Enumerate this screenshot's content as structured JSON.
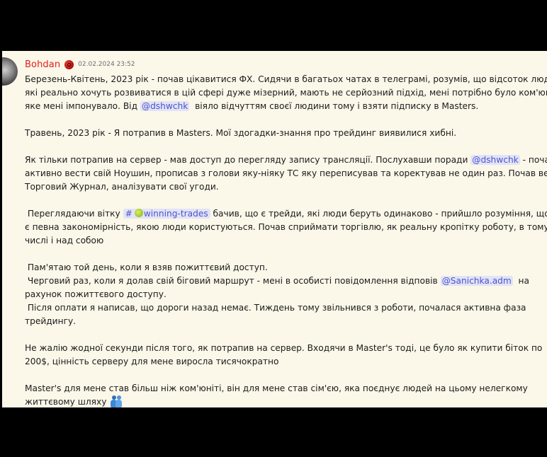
{
  "message": {
    "author": "Bohdan",
    "author_color": "#e0211b",
    "badge_icon": "role-badge-icon",
    "timestamp": "02.02.2024 23:52",
    "p1": {
      "l1": "Березень-Квітень, 2023 рік - почав цікавитися ФХ. Сидячи в багатьох чатах в телеграмі, розумів, що відсоток людей,",
      "l2": "які реально хочуть розвиватися в цій сфері дуже мізерний, мають не серйозний підхід, мені потрібно було ком'юніті,",
      "l3_a": "яке мені імпонувало. Від ",
      "mention": "@dshwchk",
      "l3_b": "  віяло відчуттям своєї людини тому і взяти підписку в Masters."
    },
    "p2": {
      "l1": "Травень, 2023 рік - Я потрапив в Masters. Мої здогадки-знання про трейдинг виявилися хибні."
    },
    "p3": {
      "l1_a": "Як тільки потрапив на сервер - мав доступ до перегляду запису трансляції. Послухавши поради ",
      "mention": "@dshwchk",
      "l1_b": " - почав",
      "l2": "активно вести свій Ноушин, прописав з голови яку-ніяку ТС яку переписував та коректував не один раз. Почав вести",
      "l3": "Торговий Журнал, аналізувати свої угоди."
    },
    "p4": {
      "l1_a": " Переглядаючи вітку ",
      "channel_hash": "#",
      "channel_icon": "tennis-ball-icon",
      "channel_name": "winning-trades",
      "l1_b": " бачив, що є трейди, які люди беруть одинаково - прийшло розуміння, що",
      "l2": "є певна закономірність, якою люди користуються. Почав сприймати торгівлю, як реальну кропітку роботу, в тому",
      "l3": "числі і над собою"
    },
    "p5": {
      "l1": " Пам'ятаю той день, коли я взяв пожиттєвий доступ.",
      "l2_a": " Черговий раз, коли я долав свій біговий маршрут - мені в особисті повідомлення відповів ",
      "mention": "@Sanichka.adm",
      "l2_b": "  на",
      "l3": "рахунок пожиттєвого доступу.",
      "l4": " Після оплати я написав, що дороги назад немає. Тиждень тому звільнився з роботи, почалася активна фаза",
      "l5": "трейдингу."
    },
    "p6": {
      "l1": "Не жалію жодної секунди після того, як потрапив на сервер. Входячи в Master's тоді, це було як купити біток по",
      "l2": "200$, цінність серверу для мене виросла тисячократно"
    },
    "p7": {
      "l1": "Master's для мене став більш ніж ком'юніті, він для мене став сім'єю, яка поєднує людей на цьому нелегкому",
      "l2": "життєвому шляху",
      "emoji_icon": "people-hugging-icon"
    }
  }
}
